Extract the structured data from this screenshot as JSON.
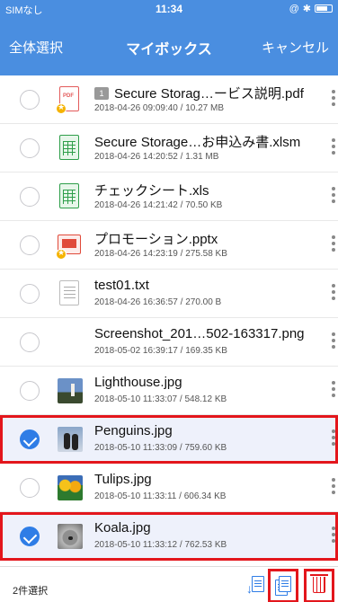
{
  "status_bar": {
    "carrier": "SIMなし",
    "time": "11:34"
  },
  "nav": {
    "select_all_label": "全体選択",
    "title": "マイボックス",
    "cancel_label": "キャンセル"
  },
  "files": [
    {
      "name": "Secure Storag…ービス説明.pdf",
      "meta": "2018-04-26 09:09:40 / 10.27 MB",
      "type": "pdf",
      "badge": "1",
      "starred": true,
      "selected": false
    },
    {
      "name": "Secure Storage…お申込み書.xlsm",
      "meta": "2018-04-26 14:20:52 / 1.31 MB",
      "type": "xls",
      "starred": false,
      "selected": false
    },
    {
      "name": "チェックシート.xls",
      "meta": "2018-04-26 14:21:42 / 70.50 KB",
      "type": "xls",
      "starred": false,
      "selected": false
    },
    {
      "name": "プロモーション.pptx",
      "meta": "2018-04-26 14:23:19 / 275.58 KB",
      "type": "ppt",
      "starred": true,
      "selected": false
    },
    {
      "name": "test01.txt",
      "meta": "2018-04-26 16:36:57 / 270.00 B",
      "type": "txt",
      "starred": false,
      "selected": false
    },
    {
      "name": "Screenshot_201…502-163317.png",
      "meta": "2018-05-02 16:39:17 / 169.35 KB",
      "type": "none",
      "starred": false,
      "selected": false
    },
    {
      "name": "Lighthouse.jpg",
      "meta": "2018-05-10 11:33:07 / 548.12 KB",
      "type": "lighthouse",
      "starred": false,
      "selected": false
    },
    {
      "name": "Penguins.jpg",
      "meta": "2018-05-10 11:33:09 / 759.60 KB",
      "type": "penguins",
      "starred": false,
      "selected": true
    },
    {
      "name": "Tulips.jpg",
      "meta": "2018-05-10 11:33:11 / 606.34 KB",
      "type": "tulips",
      "starred": false,
      "selected": false
    },
    {
      "name": "Koala.jpg",
      "meta": "2018-05-10 11:33:12 / 762.53 KB",
      "type": "koala",
      "starred": false,
      "selected": true
    }
  ],
  "toolbar": {
    "selected_count": "2件選択"
  }
}
